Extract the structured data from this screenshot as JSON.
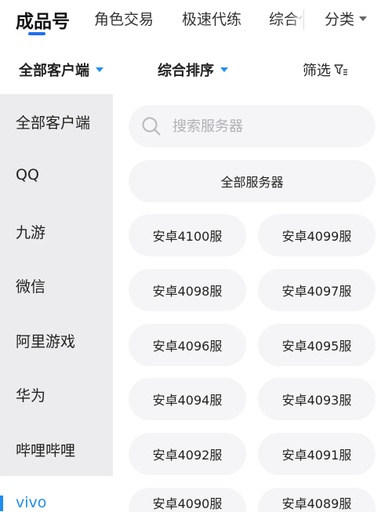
{
  "top_tabs": {
    "items": [
      "成品号",
      "角色交易",
      "极速代练",
      "综合代练"
    ],
    "category_label": "分类",
    "accent": "#1f6ef0"
  },
  "filters": {
    "client_label": "全部客户端",
    "sort_label": "综合排序",
    "screen_label": "筛选"
  },
  "sidebar": {
    "items": [
      {
        "label": "全部客户端"
      },
      {
        "label": "QQ"
      },
      {
        "label": "九游"
      },
      {
        "label": "微信"
      },
      {
        "label": "阿里游戏"
      },
      {
        "label": "华为"
      },
      {
        "label": "哔哩哔哩"
      },
      {
        "label": "vivo"
      }
    ],
    "active_index": 7,
    "active_color": "#1f8ef0"
  },
  "main": {
    "search_placeholder": "搜索服务器",
    "all_servers_label": "全部服务器",
    "servers": [
      "安卓4100服",
      "安卓4099服",
      "安卓4098服",
      "安卓4097服",
      "安卓4096服",
      "安卓4095服",
      "安卓4094服",
      "安卓4093服",
      "安卓4092服",
      "安卓4091服",
      "安卓4090服",
      "安卓4089服"
    ]
  }
}
